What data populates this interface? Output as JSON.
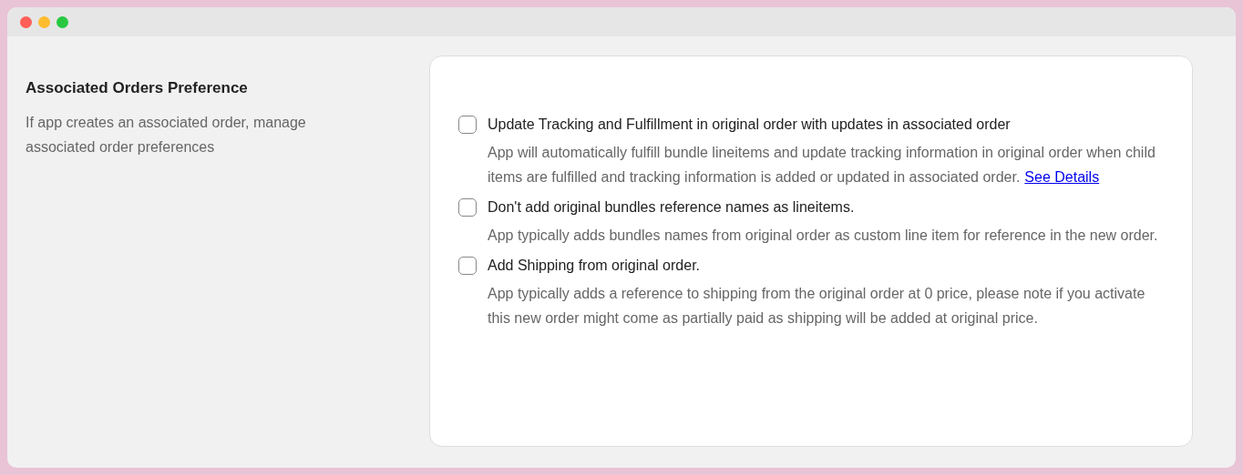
{
  "window": {
    "controls": [
      {
        "color": "#ff5f57"
      },
      {
        "color": "#febc2e"
      },
      {
        "color": "#28c840"
      }
    ]
  },
  "section": {
    "title": "Associated Orders Preference",
    "description": "If app creates an associated order, manage associated order preferences"
  },
  "options": [
    {
      "label": "Update Tracking and Fulfillment in original order with updates in associated order",
      "checked": false,
      "description": "App will automatically fulfill bundle lineitems and update tracking information in original order when child items are fulfilled and tracking information is added or updated in associated order.",
      "link": "See Details"
    },
    {
      "label": "Don't add original bundles reference names as lineitems.",
      "checked": false,
      "description": "App typically adds bundles names from original order as custom line item for reference in the new order."
    },
    {
      "label": "Add Shipping from original order.",
      "checked": false,
      "description": "App typically adds a reference to shipping from the original order at 0 price, please note if you activate this new order might come as partially paid as shipping will be added at original price."
    }
  ]
}
